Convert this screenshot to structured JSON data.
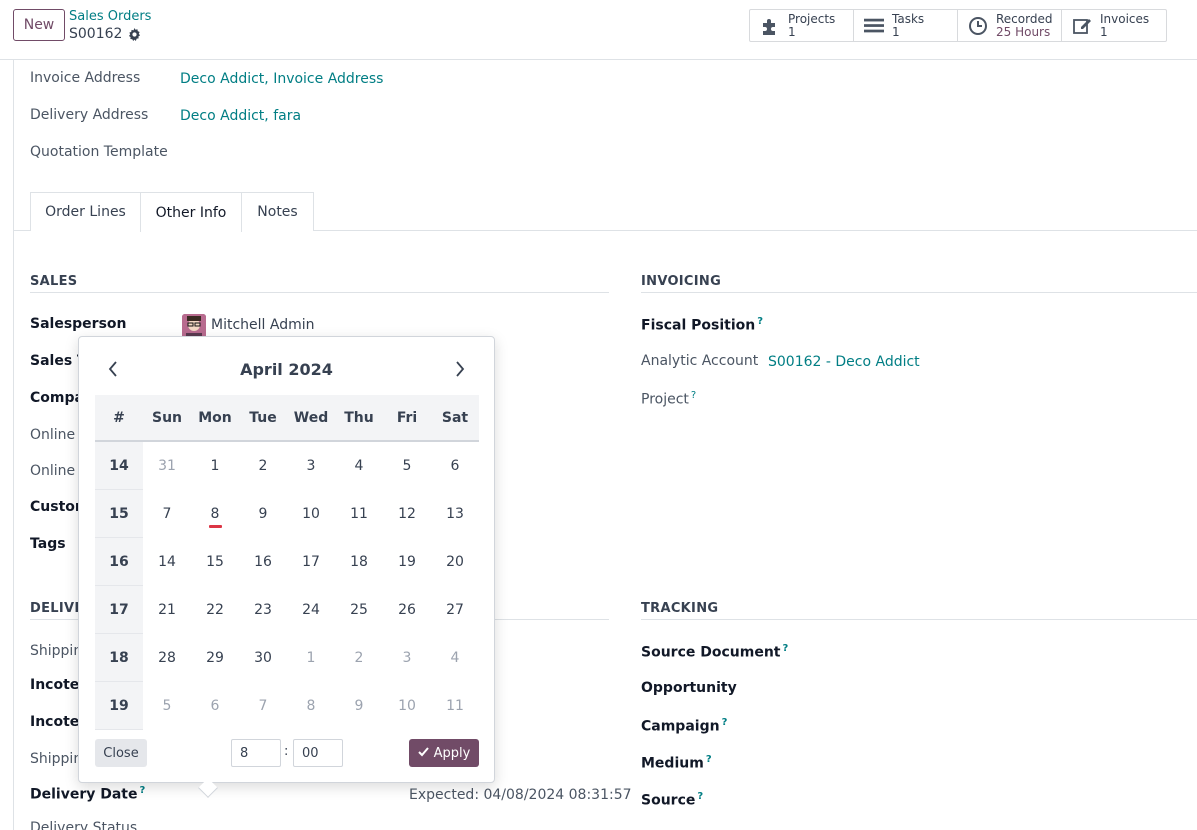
{
  "topbar": {
    "new_label": "New",
    "breadcrumb_parent": "Sales Orders",
    "breadcrumb_current": "S00162"
  },
  "smart_buttons": [
    {
      "label": "Projects",
      "value": "1",
      "icon": "puzzle-icon"
    },
    {
      "label": "Tasks",
      "value": "1",
      "icon": "tasks-icon"
    },
    {
      "label": "Recorded",
      "value": "25 Hours",
      "icon": "clock-icon"
    },
    {
      "label": "Invoices",
      "value": "1",
      "icon": "pencil-square-icon"
    }
  ],
  "header_fields": {
    "invoice_address_label": "Invoice Address",
    "invoice_address_value": "Deco Addict, Invoice Address",
    "delivery_address_label": "Delivery Address",
    "delivery_address_value": "Deco Addict, fara",
    "quotation_template_label": "Quotation Template"
  },
  "tabs": [
    "Order Lines",
    "Other Info",
    "Notes"
  ],
  "sales": {
    "title": "SALES",
    "salesperson_label": "Salesperson",
    "salesperson_value": "Mitchell Admin",
    "sales_team_label": "Sales Te",
    "company_label": "Compa",
    "online_1_label": "Online",
    "online_2_label": "Online",
    "customer_label": "Custom",
    "tags_label": "Tags"
  },
  "delivery": {
    "title": "DELIVE",
    "shipping_label": "Shippin",
    "incoterm_label": "Incoter",
    "incoterm2_label": "Incoter",
    "shipping2_label": "Shippin",
    "delivery_date_label": "Delivery Date",
    "expected_text": "Expected: 04/08/2024 08:31:57",
    "delivery_status_label": "Delivery Status"
  },
  "invoicing": {
    "title": "INVOICING",
    "fiscal_position_label": "Fiscal Position",
    "analytic_account_label": "Analytic Account",
    "analytic_account_value": "S00162 - Deco Addict",
    "project_label": "Project"
  },
  "tracking": {
    "title": "TRACKING",
    "source_document_label": "Source Document",
    "opportunity_label": "Opportunity",
    "campaign_label": "Campaign",
    "medium_label": "Medium",
    "source_label": "Source"
  },
  "help_mark": "?",
  "datepicker": {
    "month_title": "April 2024",
    "week_header": "#",
    "weekdays": [
      "Sun",
      "Mon",
      "Tue",
      "Wed",
      "Thu",
      "Fri",
      "Sat"
    ],
    "weeks": [
      {
        "week": "14",
        "days": [
          "31",
          "1",
          "2",
          "3",
          "4",
          "5",
          "6"
        ],
        "other": [
          true,
          false,
          false,
          false,
          false,
          false,
          false
        ]
      },
      {
        "week": "15",
        "days": [
          "7",
          "8",
          "9",
          "10",
          "11",
          "12",
          "13"
        ],
        "other": [
          false,
          false,
          false,
          false,
          false,
          false,
          false
        ]
      },
      {
        "week": "16",
        "days": [
          "14",
          "15",
          "16",
          "17",
          "18",
          "19",
          "20"
        ],
        "other": [
          false,
          false,
          false,
          false,
          false,
          false,
          false
        ]
      },
      {
        "week": "17",
        "days": [
          "21",
          "22",
          "23",
          "24",
          "25",
          "26",
          "27"
        ],
        "other": [
          false,
          false,
          false,
          false,
          false,
          false,
          false
        ]
      },
      {
        "week": "18",
        "days": [
          "28",
          "29",
          "30",
          "1",
          "2",
          "3",
          "4"
        ],
        "other": [
          false,
          false,
          false,
          true,
          true,
          true,
          true
        ]
      },
      {
        "week": "19",
        "days": [
          "5",
          "6",
          "7",
          "8",
          "9",
          "10",
          "11"
        ],
        "other": [
          true,
          true,
          true,
          true,
          true,
          true,
          true
        ]
      }
    ],
    "today": "8",
    "close_label": "Close",
    "hour_value": "8",
    "minute_value": "00",
    "colon": ":",
    "apply_label": "Apply"
  },
  "colors": {
    "brand": "#714b67",
    "link": "#017e84",
    "today_marker": "#dc3545"
  }
}
